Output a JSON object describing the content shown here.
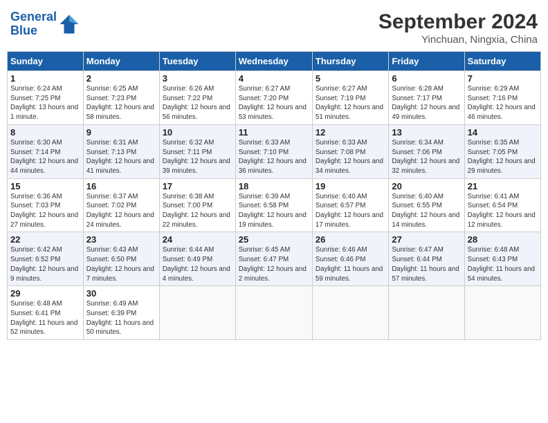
{
  "header": {
    "logo_line1": "General",
    "logo_line2": "Blue",
    "title": "September 2024",
    "subtitle": "Yinchuan, Ningxia, China"
  },
  "days_of_week": [
    "Sunday",
    "Monday",
    "Tuesday",
    "Wednesday",
    "Thursday",
    "Friday",
    "Saturday"
  ],
  "weeks": [
    [
      {
        "day": "1",
        "sunrise": "6:24 AM",
        "sunset": "7:25 PM",
        "daylight": "13 hours and 1 minute."
      },
      {
        "day": "2",
        "sunrise": "6:25 AM",
        "sunset": "7:23 PM",
        "daylight": "12 hours and 58 minutes."
      },
      {
        "day": "3",
        "sunrise": "6:26 AM",
        "sunset": "7:22 PM",
        "daylight": "12 hours and 56 minutes."
      },
      {
        "day": "4",
        "sunrise": "6:27 AM",
        "sunset": "7:20 PM",
        "daylight": "12 hours and 53 minutes."
      },
      {
        "day": "5",
        "sunrise": "6:27 AM",
        "sunset": "7:19 PM",
        "daylight": "12 hours and 51 minutes."
      },
      {
        "day": "6",
        "sunrise": "6:28 AM",
        "sunset": "7:17 PM",
        "daylight": "12 hours and 49 minutes."
      },
      {
        "day": "7",
        "sunrise": "6:29 AM",
        "sunset": "7:16 PM",
        "daylight": "12 hours and 46 minutes."
      }
    ],
    [
      {
        "day": "8",
        "sunrise": "6:30 AM",
        "sunset": "7:14 PM",
        "daylight": "12 hours and 44 minutes."
      },
      {
        "day": "9",
        "sunrise": "6:31 AM",
        "sunset": "7:13 PM",
        "daylight": "12 hours and 41 minutes."
      },
      {
        "day": "10",
        "sunrise": "6:32 AM",
        "sunset": "7:11 PM",
        "daylight": "12 hours and 39 minutes."
      },
      {
        "day": "11",
        "sunrise": "6:33 AM",
        "sunset": "7:10 PM",
        "daylight": "12 hours and 36 minutes."
      },
      {
        "day": "12",
        "sunrise": "6:33 AM",
        "sunset": "7:08 PM",
        "daylight": "12 hours and 34 minutes."
      },
      {
        "day": "13",
        "sunrise": "6:34 AM",
        "sunset": "7:06 PM",
        "daylight": "12 hours and 32 minutes."
      },
      {
        "day": "14",
        "sunrise": "6:35 AM",
        "sunset": "7:05 PM",
        "daylight": "12 hours and 29 minutes."
      }
    ],
    [
      {
        "day": "15",
        "sunrise": "6:36 AM",
        "sunset": "7:03 PM",
        "daylight": "12 hours and 27 minutes."
      },
      {
        "day": "16",
        "sunrise": "6:37 AM",
        "sunset": "7:02 PM",
        "daylight": "12 hours and 24 minutes."
      },
      {
        "day": "17",
        "sunrise": "6:38 AM",
        "sunset": "7:00 PM",
        "daylight": "12 hours and 22 minutes."
      },
      {
        "day": "18",
        "sunrise": "6:39 AM",
        "sunset": "6:58 PM",
        "daylight": "12 hours and 19 minutes."
      },
      {
        "day": "19",
        "sunrise": "6:40 AM",
        "sunset": "6:57 PM",
        "daylight": "12 hours and 17 minutes."
      },
      {
        "day": "20",
        "sunrise": "6:40 AM",
        "sunset": "6:55 PM",
        "daylight": "12 hours and 14 minutes."
      },
      {
        "day": "21",
        "sunrise": "6:41 AM",
        "sunset": "6:54 PM",
        "daylight": "12 hours and 12 minutes."
      }
    ],
    [
      {
        "day": "22",
        "sunrise": "6:42 AM",
        "sunset": "6:52 PM",
        "daylight": "12 hours and 9 minutes."
      },
      {
        "day": "23",
        "sunrise": "6:43 AM",
        "sunset": "6:50 PM",
        "daylight": "12 hours and 7 minutes."
      },
      {
        "day": "24",
        "sunrise": "6:44 AM",
        "sunset": "6:49 PM",
        "daylight": "12 hours and 4 minutes."
      },
      {
        "day": "25",
        "sunrise": "6:45 AM",
        "sunset": "6:47 PM",
        "daylight": "12 hours and 2 minutes."
      },
      {
        "day": "26",
        "sunrise": "6:46 AM",
        "sunset": "6:46 PM",
        "daylight": "11 hours and 59 minutes."
      },
      {
        "day": "27",
        "sunrise": "6:47 AM",
        "sunset": "6:44 PM",
        "daylight": "11 hours and 57 minutes."
      },
      {
        "day": "28",
        "sunrise": "6:48 AM",
        "sunset": "6:43 PM",
        "daylight": "11 hours and 54 minutes."
      }
    ],
    [
      {
        "day": "29",
        "sunrise": "6:48 AM",
        "sunset": "6:41 PM",
        "daylight": "11 hours and 52 minutes."
      },
      {
        "day": "30",
        "sunrise": "6:49 AM",
        "sunset": "6:39 PM",
        "daylight": "11 hours and 50 minutes."
      },
      null,
      null,
      null,
      null,
      null
    ]
  ]
}
